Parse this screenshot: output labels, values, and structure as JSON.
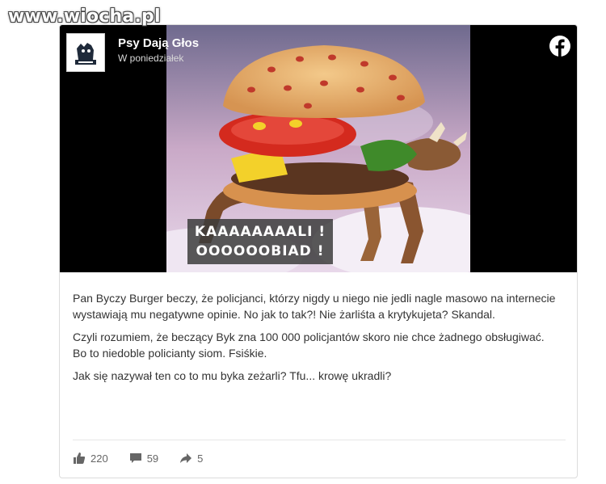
{
  "watermark": "www.wiocha.pl",
  "post": {
    "page_name": "Psy Dają Głos",
    "time": "W poniedziałek",
    "image_caption": [
      "KAAAAAAAALI !",
      "OOOOOOBIAD !"
    ],
    "paragraphs": [
      "Pan Byczy Burger beczy, że policjanci, którzy nigdy u niego nie jedli nagle masowo na internecie wystawiają mu negatywne opinie. No jak to tak?! Nie żarliśta a krytykujeta? Skandal.",
      "Czyli rozumiem, że beczący Byk zna 100 000 policjantów skoro nie chce żadnego obsługiwać.",
      "Bo to niedoble policianty siom. Fsiśkie.",
      "Jak się nazywał ten co to mu byka zeżarli? Tfu... krowę ukradli?"
    ],
    "stats": {
      "likes": "220",
      "comments": "59",
      "shares": "5"
    }
  },
  "icons": {
    "brand": "facebook-icon",
    "like": "thumbs-up-icon",
    "comment": "comment-icon",
    "share": "share-arrow-icon"
  },
  "colors": {
    "facebook": "#ffffff",
    "text": "#333333",
    "muted": "#666666"
  }
}
